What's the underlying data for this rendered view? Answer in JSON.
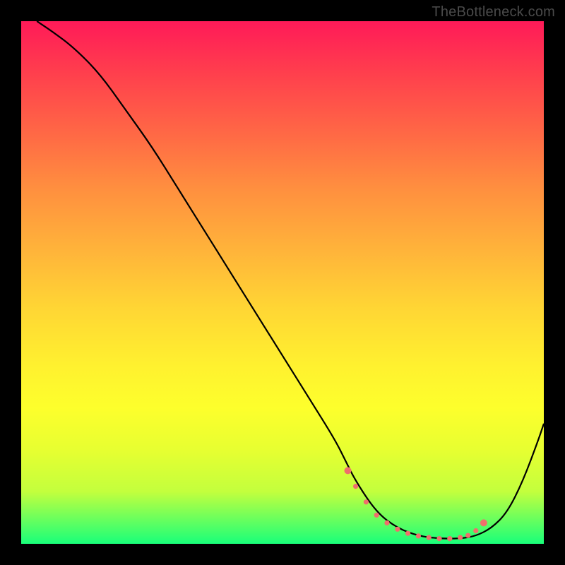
{
  "attribution": "TheBottleneck.com",
  "chart_data": {
    "type": "line",
    "title": "",
    "xlabel": "",
    "ylabel": "",
    "xlim": [
      0,
      100
    ],
    "ylim": [
      0,
      100
    ],
    "grid": false,
    "legend": false,
    "series": [
      {
        "name": "bottleneck-curve",
        "color": "#000000",
        "x": [
          3,
          6,
          10,
          15,
          20,
          25,
          30,
          35,
          40,
          45,
          50,
          55,
          60,
          62,
          64,
          68,
          72,
          76,
          80,
          84,
          87,
          90,
          93,
          96,
          99,
          100
        ],
        "y": [
          100,
          98,
          95,
          90,
          83,
          76,
          68,
          60,
          52,
          44,
          36,
          28,
          20,
          16,
          12,
          6,
          3,
          1.5,
          1,
          1,
          1.5,
          3,
          6,
          12,
          20,
          23
        ]
      }
    ],
    "markers": {
      "name": "highlight-segment",
      "color": "#ef6f6c",
      "style": "dotted",
      "x": [
        62.5,
        64,
        66,
        68,
        70,
        72,
        74,
        76,
        78,
        80,
        82,
        84,
        85.5,
        87,
        88.5
      ],
      "y": [
        14,
        11,
        8,
        5.5,
        4,
        2.8,
        2,
        1.5,
        1.2,
        1,
        1,
        1.2,
        1.6,
        2.5,
        4
      ]
    },
    "background_gradient": {
      "direction": "vertical",
      "stops": [
        {
          "pos": 0,
          "color": "#ff1a58"
        },
        {
          "pos": 22,
          "color": "#ff6a45"
        },
        {
          "pos": 44,
          "color": "#ffb43a"
        },
        {
          "pos": 66,
          "color": "#fff12f"
        },
        {
          "pos": 90,
          "color": "#c3ff3d"
        },
        {
          "pos": 100,
          "color": "#19ff7a"
        }
      ]
    }
  }
}
